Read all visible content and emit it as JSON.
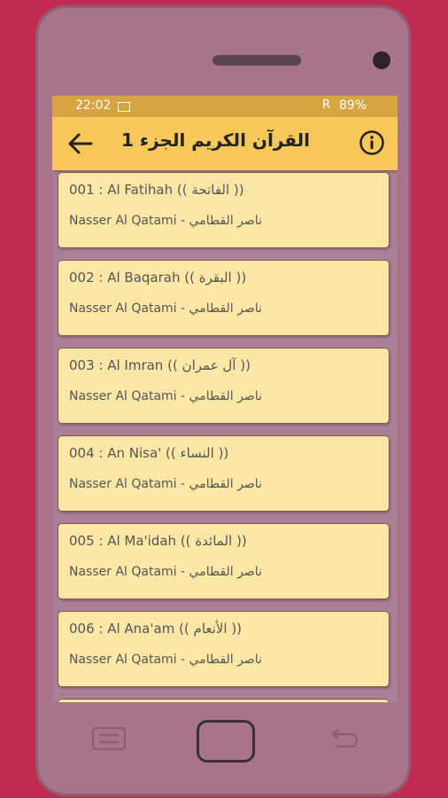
{
  "status_bar": {
    "time": "22:02",
    "signal": "R",
    "battery": "89%"
  },
  "app_bar": {
    "title": "القرآن الكريم الجزء 1"
  },
  "surahs": [
    {
      "title": "001 : Al Fatihah (( الفاتحة ))",
      "reciter": "Nasser Al Qatami - ناصر القطامي"
    },
    {
      "title": "002 : Al Baqarah (( البقرة ))",
      "reciter": "Nasser Al Qatami - ناصر القطامي"
    },
    {
      "title": "003 : Al Imran (( آل عمران ))",
      "reciter": "Nasser Al Qatami - ناصر القطامي"
    },
    {
      "title": "004 : An Nisa' (( النساء ))",
      "reciter": "Nasser Al Qatami - ناصر القطامي"
    },
    {
      "title": "005 : Al Ma'idah (( المائدة ))",
      "reciter": "Nasser Al Qatami - ناصر القطامي"
    },
    {
      "title": "006 :  Al Ana'am (( الأنعام ))",
      "reciter": "Nasser Al Qatami - ناصر القطامي"
    }
  ],
  "colors": {
    "background": "#c02c4f",
    "phone": "#a8748c",
    "status_bar": "#d8a442",
    "app_bar": "#f8c95a",
    "card": "#fde7a6"
  },
  "icons": {
    "back": "arrow-left-icon",
    "info": "info-icon",
    "menu": "menu-icon",
    "home": "home-button",
    "nav_back": "return-icon"
  }
}
